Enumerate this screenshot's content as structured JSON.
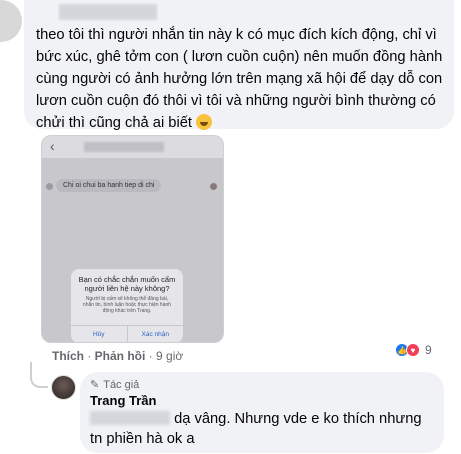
{
  "comment": {
    "text": "theo tôi thì người nhắn tin này k có mục đích kích động, chỉ vì bức xúc, ghê tởm con ( lươn cuồn cuộn) nên muốn đồng hành cùng người có ảnh hưởng lớn trên mạng xã hội để dạy dỗ con lươn cuồn cuộn đó thôi vì tôi và những người bình thường có chửi thì cũng chả ai biết",
    "emoji": "smile-emoji",
    "action_like": "Thích",
    "action_reply": "Phản hồi",
    "time": "9 giờ",
    "reaction_count": "9"
  },
  "attachment": {
    "message": "Chi oi chui ba hanh tiep di chi",
    "time_label": "",
    "dialog_title": "Bạn có chắc chắn muốn cấm người liên hệ này không?",
    "dialog_body": "Người bị cấm sẽ không thể đăng bài, nhắn tin, bình luận hoặc thực hiện hành động khác trên Trang.",
    "cancel_label": "Hủy",
    "confirm_label": "Xác nhận"
  },
  "reply": {
    "author_tag": "Tác giả",
    "author_name": "Trang Trần",
    "text_main": " dạ vâng. Nhưng vde e ko thích nhưng tn phiền hà ok a"
  },
  "colors": {
    "bubble_bg": "#f0f2f5",
    "meta_text": "#65676b",
    "like_blue": "#1877f2",
    "love_red": "#f33e58"
  }
}
